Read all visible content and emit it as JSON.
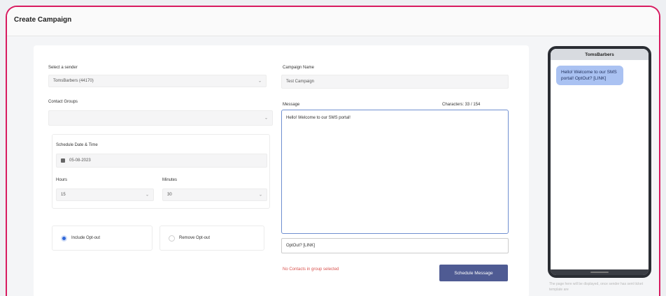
{
  "page": {
    "title": "Create Campaign"
  },
  "form": {
    "sender": {
      "label": "Select a sender",
      "value": "TomsBarbers (44170)"
    },
    "contact_groups": {
      "label": "Contact Groups",
      "value": ""
    },
    "schedule": {
      "label": "Schedule Date & Time",
      "date": "05-08-2023",
      "hours_label": "Hours",
      "hours_value": "15",
      "minutes_label": "Minutes",
      "minutes_value": "30"
    },
    "opt_out": {
      "include_label": "Include Opt-out",
      "remove_label": "Remove Opt-out",
      "selected": "include"
    },
    "campaign_name": {
      "label": "Campaign Name",
      "value": "Test Campaign"
    },
    "message": {
      "label": "Message",
      "characters": "Characters: 33 / 154",
      "value": "Hello! Welcome to our SMS portal!",
      "opt_out_text": "OptOut? [LINK]"
    },
    "error": "No Contacts in group selected",
    "submit_label": "Schedule Message"
  },
  "preview": {
    "sender_name": "TomsBarbers",
    "message": "Hello! Welcome to our SMS portal! OptOut? [LINK]",
    "note": "The page here will be displayed, once sender has sent ticket template are"
  }
}
